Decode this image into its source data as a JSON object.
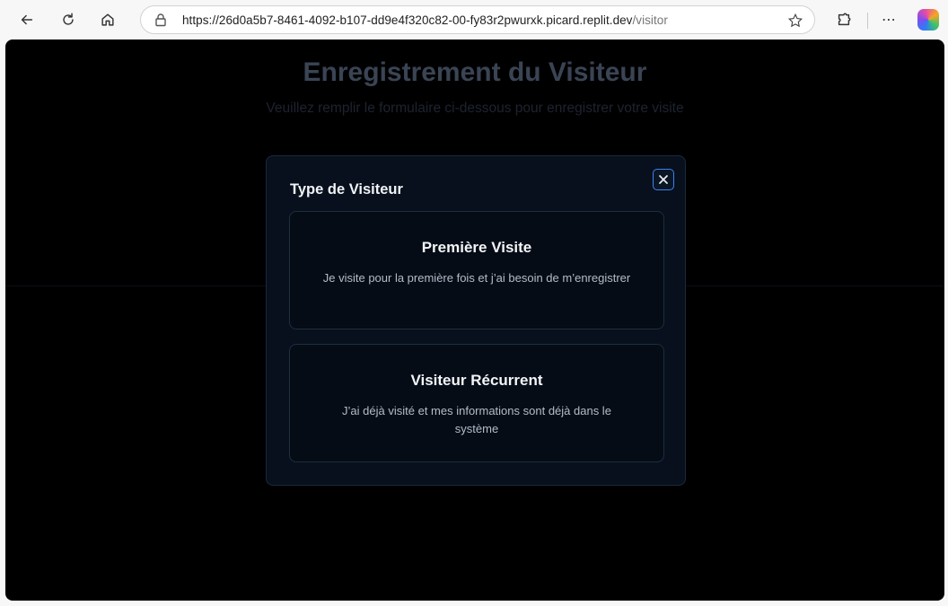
{
  "browser": {
    "url_host": "https://26d0a5b7-8461-4092-b107-dd9e4f320c82-00-fy83r2pwurxk.picard.replit.dev",
    "url_path": "/visitor",
    "more_label": "⋯"
  },
  "page": {
    "title": "Enregistrement du Visiteur",
    "subtitle": "Veuillez remplir le formulaire ci-dessous pour enregistrer votre visite"
  },
  "modal": {
    "title": "Type de Visiteur",
    "close_icon": "x-icon",
    "options": [
      {
        "title": "Première Visite",
        "description": "Je visite pour la première fois et j’ai besoin de m’enregistrer"
      },
      {
        "title": "Visiteur Récurrent",
        "description": "J’ai déjà visité et mes informations sont déjà dans le système"
      }
    ]
  },
  "colors": {
    "page_background": "#000000",
    "modal_background": "#07101c",
    "accent": "#3b82f6"
  }
}
